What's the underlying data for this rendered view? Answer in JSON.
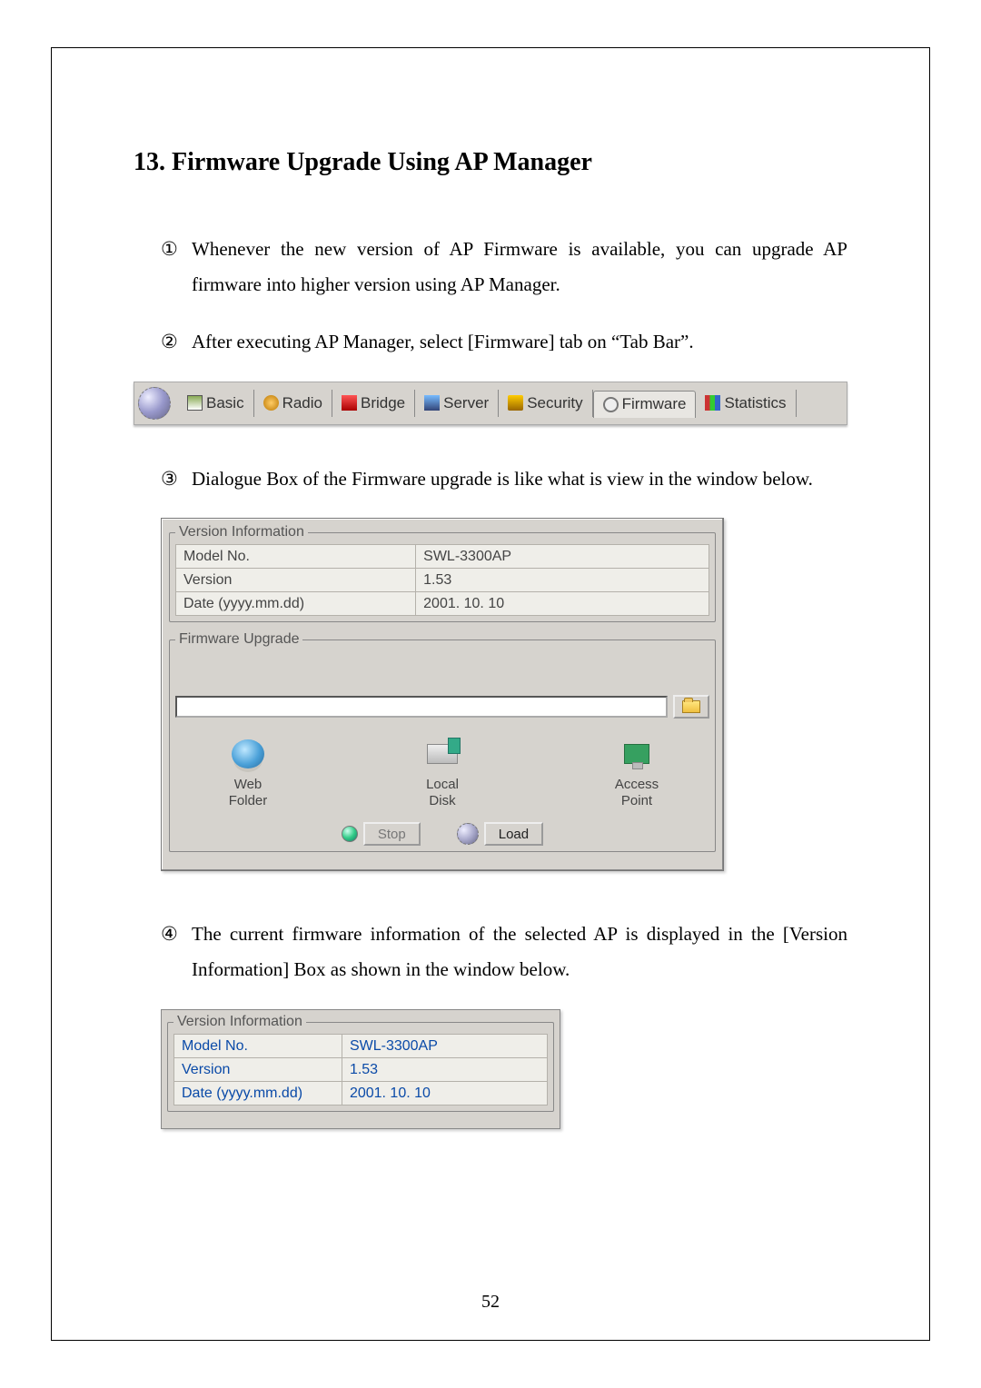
{
  "heading": "13. Firmware Upgrade Using AP Manager",
  "items": {
    "i1": "Whenever the new version of AP Firmware is available, you can upgrade AP firmware into higher version using AP Manager.",
    "i2": "After executing AP Manager, select [Firmware] tab on “Tab Bar”.",
    "i3": "Dialogue Box of the Firmware upgrade is like what is view in the window below.",
    "i4": "The current firmware information of the selected AP is displayed in the [Version Information] Box as shown in the window below."
  },
  "markers": {
    "m1": "①",
    "m2": "②",
    "m3": "③",
    "m4": "④"
  },
  "tabs": {
    "basic": "Basic",
    "radio": "Radio",
    "bridge": "Bridge",
    "server": "Server",
    "security": "Security",
    "firmware": "Firmware",
    "statistics": "Statistics"
  },
  "dlg": {
    "version_legend": "Version Information",
    "upgrade_legend": "Firmware Upgrade",
    "rows": {
      "model_label": "Model No.",
      "model_value": "SWL-3300AP",
      "version_label": "Version",
      "version_value": "1.53",
      "date_label": "Date (yyyy.mm.dd)",
      "date_value": "2001. 10. 10"
    },
    "targets": {
      "web1": "Web",
      "web2": "Folder",
      "local1": "Local",
      "local2": "Disk",
      "ap1": "Access",
      "ap2": "Point"
    },
    "buttons": {
      "stop": "Stop",
      "load": "Load"
    }
  },
  "page_number": "52"
}
